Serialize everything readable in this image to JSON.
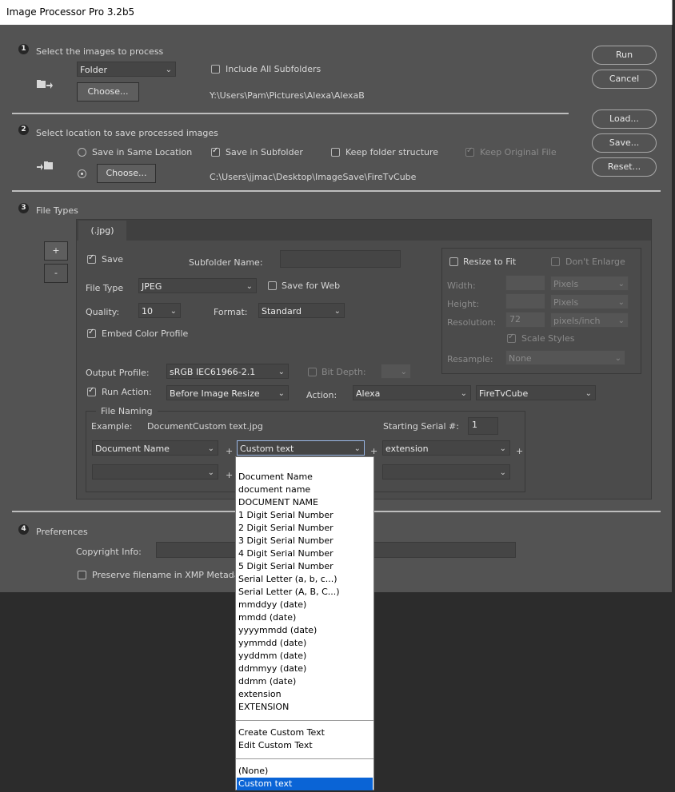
{
  "window": {
    "title": "Image Processor Pro 3.2b5"
  },
  "section1": {
    "number": "1",
    "title": "Select the images to process",
    "source_select": "Folder",
    "choose_label": "Choose...",
    "include_subfolders_label": "Include All Subfolders",
    "include_subfolders_checked": false,
    "source_path": "Y:\\Users\\Pam\\Pictures\\Alexa\\AlexaB"
  },
  "section2": {
    "number": "2",
    "title": "Select location to save processed images",
    "save_same_label": "Save in Same Location",
    "save_subfolder_label": "Save in Subfolder",
    "save_subfolder_checked": true,
    "keep_structure_label": "Keep folder structure",
    "keep_original_label": "Keep Original File",
    "choose_label": "Choose...",
    "dest_path": "C:\\Users\\jjmac\\Desktop\\ImageSave\\FireTvCube"
  },
  "side_buttons": {
    "run": "Run",
    "cancel": "Cancel",
    "load": "Load...",
    "save": "Save...",
    "reset": "Reset..."
  },
  "section3": {
    "number": "3",
    "title": "File Types",
    "add_label": "+",
    "remove_label": "-",
    "tab_label": "(.jpg)",
    "save_label": "Save",
    "subfolder_name_label": "Subfolder Name:",
    "subfolder_name_value": "",
    "file_type_label": "File Type",
    "file_type_value": "JPEG",
    "save_for_web_label": "Save for Web",
    "quality_label": "Quality:",
    "quality_value": "10",
    "format_label": "Format:",
    "format_value": "Standard",
    "embed_profile_label": "Embed Color Profile",
    "resize": {
      "resize_to_fit_label": "Resize to Fit",
      "dont_enlarge_label": "Don't Enlarge",
      "width_label": "Width:",
      "height_label": "Height:",
      "resolution_label": "Resolution:",
      "resolution_value": "72",
      "width_unit": "Pixels",
      "height_unit": "Pixels",
      "resolution_unit": "pixels/inch",
      "scale_styles_label": "Scale Styles",
      "resample_label": "Resample:",
      "resample_value": "None"
    },
    "output_profile_label": "Output Profile:",
    "output_profile_value": "sRGB IEC61966-2.1",
    "bit_depth_label": "Bit Depth:",
    "run_action_label": "Run Action:",
    "run_action_when": "Before Image Resize",
    "action_label": "Action:",
    "action_set": "Alexa",
    "action_name": "FireTvCube"
  },
  "file_naming": {
    "legend": "File Naming",
    "example_label": "Example:",
    "example_value": "DocumentCustom text.jpg",
    "starting_serial_label": "Starting Serial #:",
    "starting_serial_value": "1",
    "field1": "Document Name",
    "field2": "Custom text",
    "field3": "extension",
    "field4": "",
    "field6": "",
    "plus": "+"
  },
  "section4": {
    "number": "4",
    "title": "Preferences",
    "copyright_label": "Copyright Info:",
    "copyright_value": "",
    "preserve_label": "Preserve filename in XMP Metadata"
  },
  "dropdown_menu": {
    "blank": "",
    "items": [
      "Document Name",
      "document name",
      "DOCUMENT NAME",
      "1 Digit Serial Number",
      "2 Digit Serial Number",
      "3 Digit Serial Number",
      "4 Digit Serial Number",
      "5 Digit Serial Number",
      "Serial Letter (a, b, c...)",
      "Serial Letter (A, B, C...)",
      "mmddyy (date)",
      "mmdd (date)",
      "yyyymmdd (date)",
      "yymmdd (date)",
      "yyddmm (date)",
      "ddmmyy (date)",
      "ddmm (date)",
      "extension",
      "EXTENSION"
    ],
    "custom_items": [
      "Create Custom Text",
      "Edit Custom Text"
    ],
    "end_items": [
      "(None)",
      "Custom text"
    ],
    "selected": "Custom text"
  }
}
